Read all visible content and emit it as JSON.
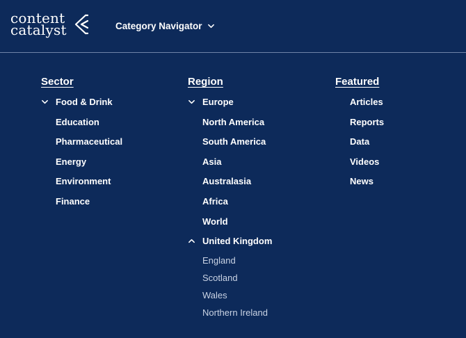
{
  "brand": {
    "line1": "content",
    "line2": "catalyst"
  },
  "nav": {
    "label": "Category Navigator"
  },
  "sector": {
    "title": "Sector",
    "items": [
      {
        "label": "Food & Drink",
        "chevron": "down"
      },
      {
        "label": "Education"
      },
      {
        "label": "Pharmaceutical"
      },
      {
        "label": "Energy"
      },
      {
        "label": "Environment"
      },
      {
        "label": "Finance"
      }
    ]
  },
  "region": {
    "title": "Region",
    "items": [
      {
        "label": "Europe",
        "chevron": "down"
      },
      {
        "label": "North America"
      },
      {
        "label": "South America"
      },
      {
        "label": "Asia"
      },
      {
        "label": "Australasia"
      },
      {
        "label": "Africa"
      },
      {
        "label": "World"
      },
      {
        "label": "United Kingdom",
        "chevron": "up"
      }
    ],
    "uk_subitems": [
      "England",
      "Scotland",
      "Wales",
      "Northern Ireland"
    ]
  },
  "featured": {
    "title": "Featured",
    "items": [
      "Articles",
      "Reports",
      "Data",
      "Videos",
      "News"
    ]
  },
  "colors": {
    "background": "#0d2a5a",
    "text": "#ffffff",
    "muted": "#c9d3e4",
    "divider": "#6f84a8"
  }
}
